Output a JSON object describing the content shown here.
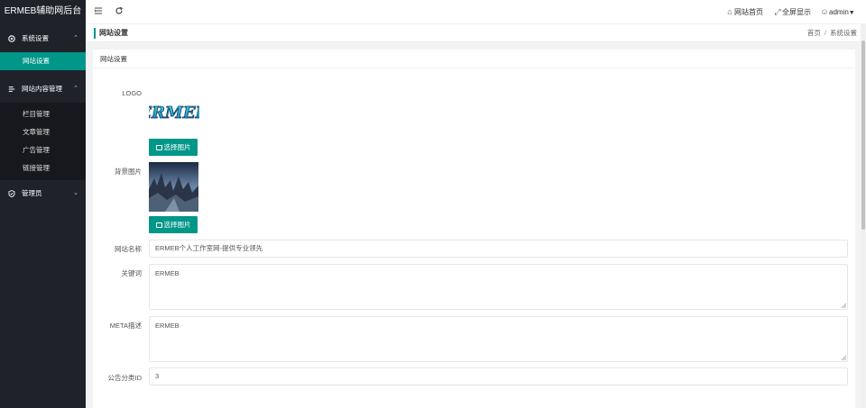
{
  "app": {
    "brand": "ERMEB辅助网后台"
  },
  "sidebar": {
    "groups": [
      {
        "label": "系统设置",
        "icon": "gear-icon",
        "caret": "^",
        "items": [
          {
            "label": "网站设置",
            "active": true
          }
        ]
      },
      {
        "label": "网站内容管理",
        "icon": "list-icon",
        "caret": "^",
        "items": [
          {
            "label": "栏目管理"
          },
          {
            "label": "文章管理"
          },
          {
            "label": "广告管理"
          },
          {
            "label": "链接管理"
          }
        ]
      },
      {
        "label": "管理员",
        "icon": "shield-icon",
        "caret": "v",
        "items": []
      }
    ]
  },
  "header": {
    "site_home": "网站首页",
    "fullscreen": "全屏显示",
    "user": "admin"
  },
  "titlebar": {
    "title": "网站设置",
    "breadcrumb": [
      "首页",
      "系统设置"
    ],
    "separator": "/"
  },
  "card": {
    "title": "网站设置",
    "fields": {
      "logo_label": "LOGO",
      "logo_text": "ERMEB",
      "select_image": "选择图片",
      "bg_label": "背景图片",
      "site_name_label": "网站名称",
      "site_name_value": "ERMEB个人工作室网-提供专业领先",
      "keywords_label": "关键词",
      "keywords_value": "ERMEB",
      "meta_label": "META描述",
      "meta_value": "ERMEB",
      "notice_label": "公告分类ID",
      "notice_value": "3"
    }
  },
  "colors": {
    "accent": "#009688",
    "sidebar_bg": "#20222a",
    "submenu_bg": "#17181d"
  }
}
